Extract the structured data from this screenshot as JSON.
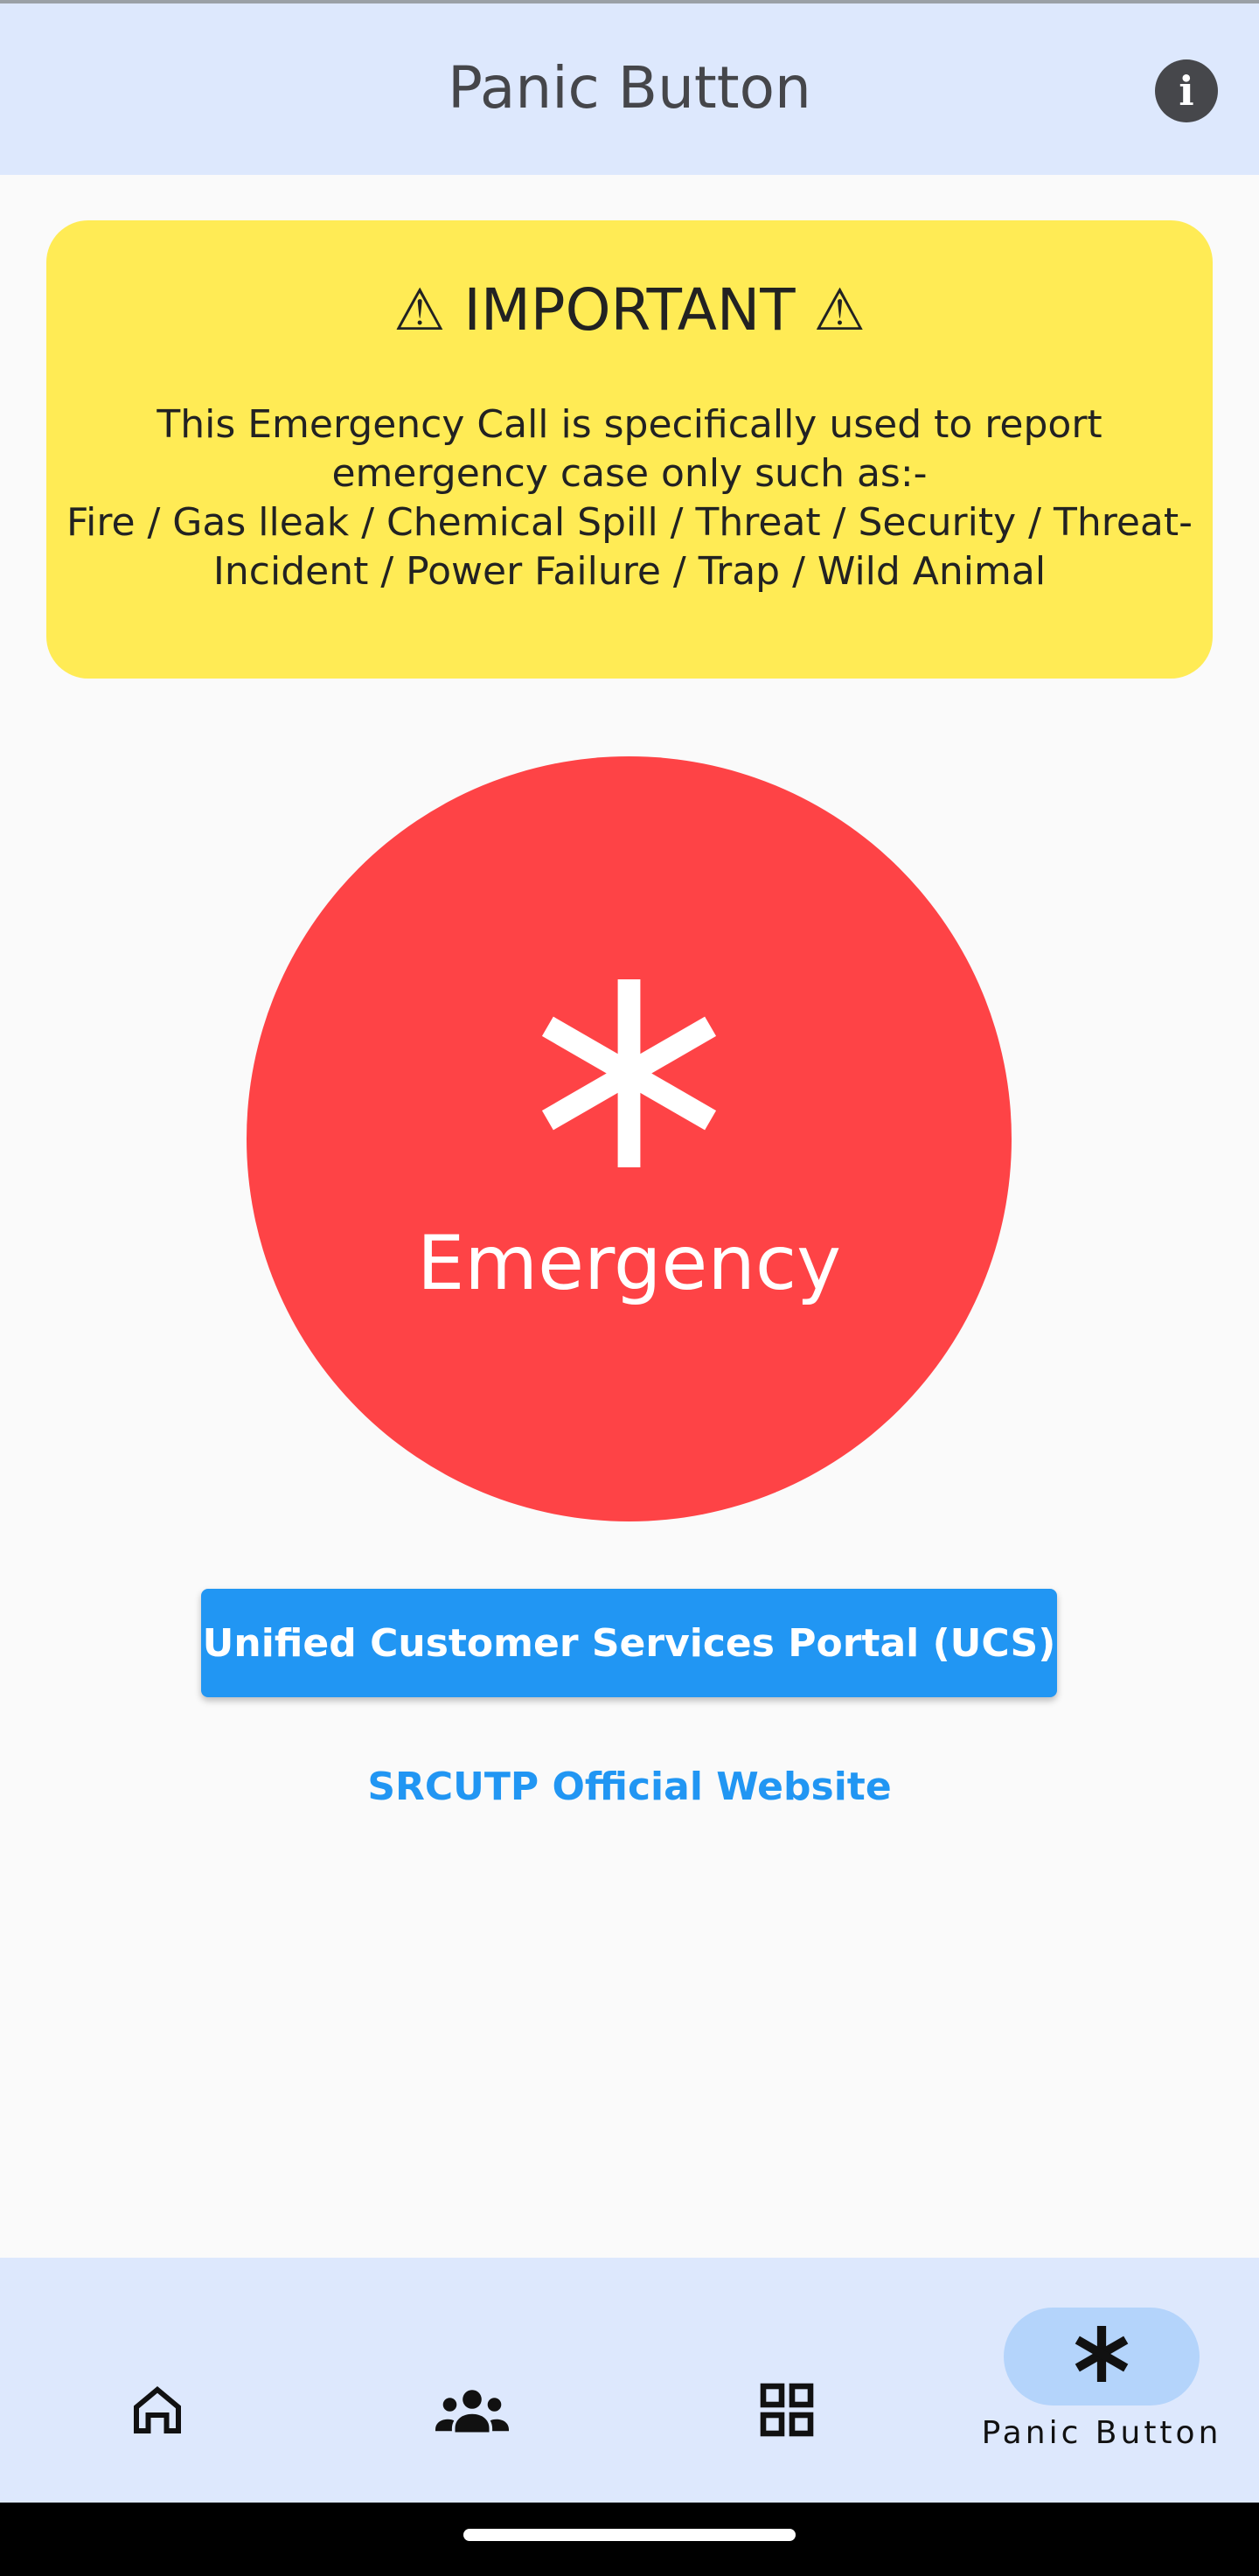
{
  "app_bar": {
    "title": "Panic Button",
    "info_icon": "info-icon"
  },
  "notice": {
    "title": "⚠ IMPORTANT ⚠",
    "line1": "This Emergency Call is specifically used to report emergency case only such as:-",
    "line2": "Fire / Gas lleak / Chemical Spill / Threat / Security / Threat-Incident / Power Failure / Trap / Wild Animal"
  },
  "emergency": {
    "label": "Emergency",
    "icon": "asterisk-icon"
  },
  "ucs_button": {
    "label": "Unified Customer Services Portal (UCS)"
  },
  "website_link": {
    "label": "SRCUTP Official Website"
  },
  "bottom_nav": {
    "items": [
      {
        "icon": "home-icon",
        "label": ""
      },
      {
        "icon": "groups-icon",
        "label": ""
      },
      {
        "icon": "grid-icon",
        "label": ""
      },
      {
        "icon": "asterisk-icon",
        "label": "Panic Button"
      }
    ],
    "active_index": 3
  },
  "colors": {
    "app_bar_bg": "#dde8fd",
    "notice_bg": "#ffeb55",
    "emergency_red": "#fe4346",
    "primary_blue": "#2196f3",
    "active_pill": "#b4d4fb"
  }
}
